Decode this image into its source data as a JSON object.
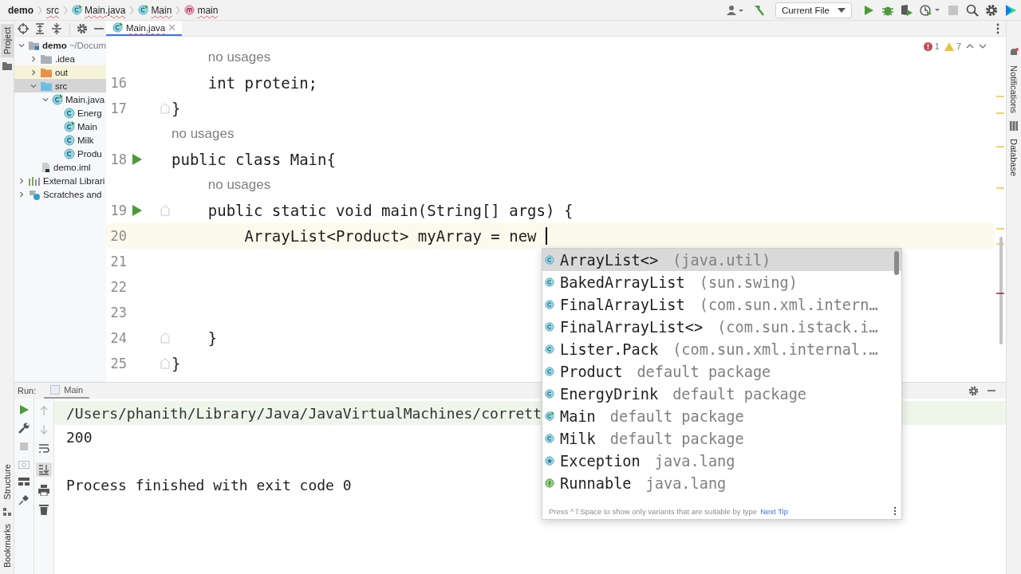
{
  "breadcrumbs": [
    {
      "label": "demo",
      "kind": "project"
    },
    {
      "label": "src",
      "kind": "folder"
    },
    {
      "label": "Main.java",
      "kind": "file"
    },
    {
      "label": "Main",
      "kind": "class"
    },
    {
      "label": "main",
      "kind": "method"
    }
  ],
  "toolbar": {
    "run_config": "Current File"
  },
  "left_tools": [
    {
      "label": "Project",
      "selected": true
    }
  ],
  "left_bottom_tools": [
    {
      "label": "Structure",
      "selected": false
    },
    {
      "label": "Bookmarks",
      "selected": false
    }
  ],
  "right_tools": [
    {
      "label": "Notifications",
      "selected": false
    },
    {
      "label": "Database",
      "selected": false
    }
  ],
  "project_tree": [
    {
      "label": "demo",
      "detail": "~/Docum",
      "kind": "module",
      "expanded": true,
      "selected": false,
      "excluded": false,
      "children": [
        {
          "label": ".idea",
          "kind": "folder",
          "expanded": false,
          "selected": false,
          "excluded": false
        },
        {
          "label": "out",
          "kind": "folder-excluded",
          "expanded": false,
          "selected": false,
          "excluded": true
        },
        {
          "label": "src",
          "kind": "folder-source",
          "expanded": true,
          "selected": true,
          "excluded": false,
          "children": [
            {
              "label": "Main.java",
              "kind": "main-class",
              "expanded": true,
              "selected": false,
              "excluded": false,
              "children": [
                {
                  "label": "Energ",
                  "kind": "class",
                  "selected": false,
                  "excluded": false
                },
                {
                  "label": "Main",
                  "kind": "main-class",
                  "selected": false,
                  "excluded": false
                },
                {
                  "label": "Milk",
                  "kind": "class",
                  "selected": false,
                  "excluded": false
                },
                {
                  "label": "Produ",
                  "kind": "class",
                  "selected": false,
                  "excluded": false
                }
              ]
            }
          ]
        },
        {
          "label": "demo.iml",
          "kind": "iml",
          "selected": false,
          "excluded": false
        }
      ]
    },
    {
      "label": "External Librari",
      "kind": "libraries",
      "expanded": false,
      "selected": false,
      "excluded": false
    },
    {
      "label": "Scratches and",
      "kind": "scratches",
      "expanded": false,
      "selected": false,
      "excluded": false
    }
  ],
  "editor_tabs": [
    {
      "label": "Main.java",
      "selected": true
    }
  ],
  "inspections": {
    "errors": "1",
    "warnings": "7"
  },
  "code_lines": [
    {
      "kind": "hint",
      "text": "no usages"
    },
    {
      "kind": "code",
      "number": "16",
      "text": "    int protein;",
      "run": false,
      "fold": false,
      "current": false
    },
    {
      "kind": "code",
      "number": "17",
      "text": "}",
      "run": false,
      "fold": true,
      "current": false
    },
    {
      "kind": "hint",
      "text": "no usages"
    },
    {
      "kind": "code",
      "number": "18",
      "text": "public class Main{",
      "run": true,
      "fold": false,
      "current": false
    },
    {
      "kind": "hint",
      "text": "no usages"
    },
    {
      "kind": "code",
      "number": "19",
      "text": "    public static void main(String[] args) {",
      "run": true,
      "fold": true,
      "current": false
    },
    {
      "kind": "code",
      "number": "20",
      "text": "        ArrayList<Product> myArray = new ",
      "run": false,
      "fold": false,
      "current": true
    },
    {
      "kind": "code",
      "number": "21",
      "run": false,
      "fold": false,
      "current": false
    },
    {
      "kind": "code",
      "number": "22",
      "run": false,
      "fold": false,
      "current": false
    },
    {
      "kind": "code",
      "number": "23",
      "run": false,
      "fold": false,
      "current": false
    },
    {
      "kind": "code",
      "number": "24",
      "text": "    }",
      "run": false,
      "fold": true,
      "current": false
    },
    {
      "kind": "code",
      "number": "25",
      "text": "}",
      "run": false,
      "fold": true,
      "current": false
    }
  ],
  "completion": {
    "items": [
      {
        "name": "ArrayList<>",
        "detail": "(java.util)",
        "kind": "class",
        "selected": true
      },
      {
        "name": "BakedArrayList",
        "detail": "(sun.swing)",
        "kind": "class",
        "selected": false
      },
      {
        "name": "FinalArrayList",
        "detail": "(com.sun.xml.intern…",
        "kind": "class",
        "selected": false
      },
      {
        "name": "FinalArrayList<>",
        "detail": "(com.sun.istack.i…",
        "kind": "class",
        "selected": false
      },
      {
        "name": "Lister.Pack",
        "detail": "(com.sun.xml.internal.…",
        "kind": "class",
        "selected": false
      },
      {
        "name": "Product",
        "detail": "default package",
        "kind": "class",
        "selected": false
      },
      {
        "name": "EnergyDrink",
        "detail": "default package",
        "kind": "class",
        "selected": false
      },
      {
        "name": "Main",
        "detail": "default package",
        "kind": "main-class",
        "selected": false
      },
      {
        "name": "Milk",
        "detail": "default package",
        "kind": "class",
        "selected": false
      },
      {
        "name": "Exception",
        "detail": "java.lang",
        "kind": "exception",
        "selected": false
      },
      {
        "name": "Runnable",
        "detail": "java.lang",
        "kind": "interface",
        "selected": false
      }
    ],
    "hint": "Press ^⇧Space to show only variants that are suitable by type",
    "link": "Next Tip"
  },
  "run_panel": {
    "label": "Run:",
    "tabs": [
      {
        "label": "Main",
        "selected": true
      }
    ],
    "output": [
      {
        "kind": "command",
        "text": "/Users/phanith/Library/Java/JavaVirtualMachines/corrett"
      },
      {
        "kind": "stdout",
        "text": "200"
      },
      {
        "kind": "status",
        "text": "Process finished with exit code 0"
      }
    ]
  }
}
